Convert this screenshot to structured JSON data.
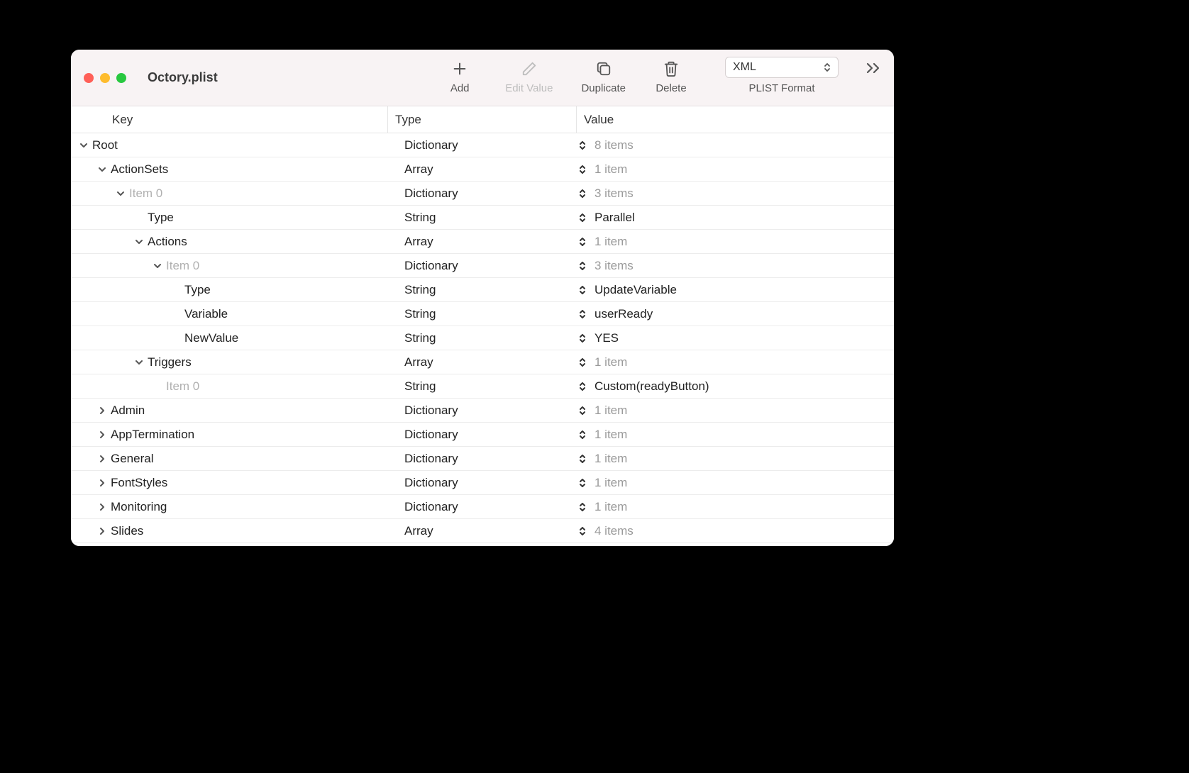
{
  "window": {
    "title": "Octory.plist"
  },
  "toolbar": {
    "add": "Add",
    "edit_value": "Edit Value",
    "duplicate": "Duplicate",
    "delete": "Delete",
    "format_selected": "XML",
    "format_label": "PLIST Format"
  },
  "columns": {
    "key": "Key",
    "type": "Type",
    "value": "Value"
  },
  "rows": [
    {
      "indent": 0,
      "chev": "down",
      "key": "Root",
      "keyDim": false,
      "type": "Dictionary",
      "value": "8 items",
      "valueDim": true
    },
    {
      "indent": 1,
      "chev": "down",
      "key": "ActionSets",
      "keyDim": false,
      "type": "Array",
      "value": "1 item",
      "valueDim": true
    },
    {
      "indent": 2,
      "chev": "down",
      "key": "Item 0",
      "keyDim": true,
      "type": "Dictionary",
      "value": "3 items",
      "valueDim": true
    },
    {
      "indent": 3,
      "chev": "none",
      "key": "Type",
      "keyDim": false,
      "type": "String",
      "value": "Parallel",
      "valueDim": false
    },
    {
      "indent": 3,
      "chev": "down",
      "key": "Actions",
      "keyDim": false,
      "type": "Array",
      "value": "1 item",
      "valueDim": true
    },
    {
      "indent": 4,
      "chev": "down",
      "key": "Item 0",
      "keyDim": true,
      "type": "Dictionary",
      "value": "3 items",
      "valueDim": true
    },
    {
      "indent": 5,
      "chev": "none",
      "key": "Type",
      "keyDim": false,
      "type": "String",
      "value": "UpdateVariable",
      "valueDim": false
    },
    {
      "indent": 5,
      "chev": "none",
      "key": "Variable",
      "keyDim": false,
      "type": "String",
      "value": "userReady",
      "valueDim": false
    },
    {
      "indent": 5,
      "chev": "none",
      "key": "NewValue",
      "keyDim": false,
      "type": "String",
      "value": "YES",
      "valueDim": false
    },
    {
      "indent": 3,
      "chev": "down",
      "key": "Triggers",
      "keyDim": false,
      "type": "Array",
      "value": "1 item",
      "valueDim": true
    },
    {
      "indent": 4,
      "chev": "none",
      "key": "Item 0",
      "keyDim": true,
      "type": "String",
      "value": "Custom(readyButton)",
      "valueDim": false
    },
    {
      "indent": 1,
      "chev": "right",
      "key": "Admin",
      "keyDim": false,
      "type": "Dictionary",
      "value": "1 item",
      "valueDim": true
    },
    {
      "indent": 1,
      "chev": "right",
      "key": "AppTermination",
      "keyDim": false,
      "type": "Dictionary",
      "value": "1 item",
      "valueDim": true
    },
    {
      "indent": 1,
      "chev": "right",
      "key": "General",
      "keyDim": false,
      "type": "Dictionary",
      "value": "1 item",
      "valueDim": true
    },
    {
      "indent": 1,
      "chev": "right",
      "key": "FontStyles",
      "keyDim": false,
      "type": "Dictionary",
      "value": "1 item",
      "valueDim": true
    },
    {
      "indent": 1,
      "chev": "right",
      "key": "Monitoring",
      "keyDim": false,
      "type": "Dictionary",
      "value": "1 item",
      "valueDim": true
    },
    {
      "indent": 1,
      "chev": "right",
      "key": "Slides",
      "keyDim": false,
      "type": "Array",
      "value": "4 items",
      "valueDim": true
    }
  ]
}
